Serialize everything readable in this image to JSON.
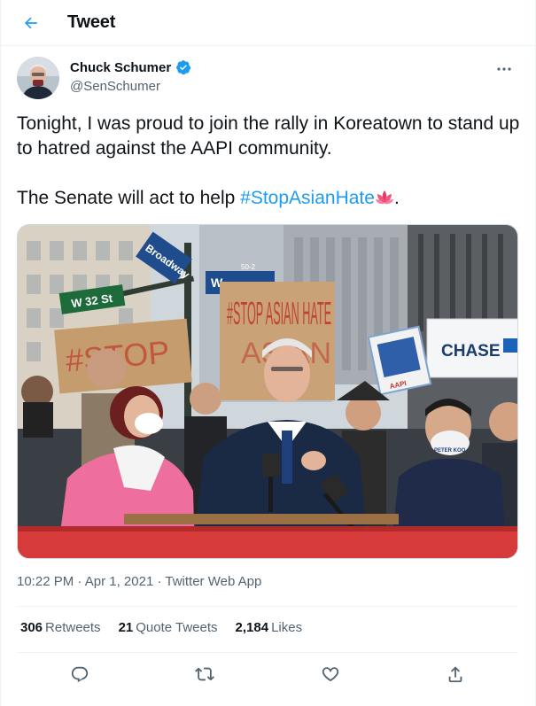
{
  "header": {
    "title": "Tweet",
    "back_icon": "arrow-left-icon"
  },
  "author": {
    "name": "Chuck Schumer",
    "handle": "@SenSchumer",
    "verified": true
  },
  "tweet": {
    "text_line1": "Tonight, I was proud to join the rally in Koreatown to stand up to hatred against the AAPI community.",
    "text_line2_prefix": "The Senate will act to help ",
    "hashtag": "#StopAsianHate",
    "text_line2_suffix": "."
  },
  "media": {
    "street_sign_1": "W 32 St",
    "street_sign_2": "Broadway",
    "street_sign_3": "W",
    "street_sign_number": "50-2",
    "poster_main": "#STOP ASIAN HATE",
    "poster_left": "#STOP",
    "poster_right": "AAPI",
    "bank_sign": "CHASE",
    "badge_text": "PETER KOO"
  },
  "meta": {
    "time": "10:22 PM",
    "date": "Apr 1, 2021",
    "source": "Twitter Web App"
  },
  "stats": {
    "retweets_count": "306",
    "retweets_label": "Retweets",
    "quotes_count": "21",
    "quotes_label": "Quote Tweets",
    "likes_count": "2,184",
    "likes_label": "Likes"
  },
  "colors": {
    "accent": "#1d9bf0",
    "text": "#0f1419",
    "secondary": "#536471",
    "divider": "#eff3f4"
  }
}
